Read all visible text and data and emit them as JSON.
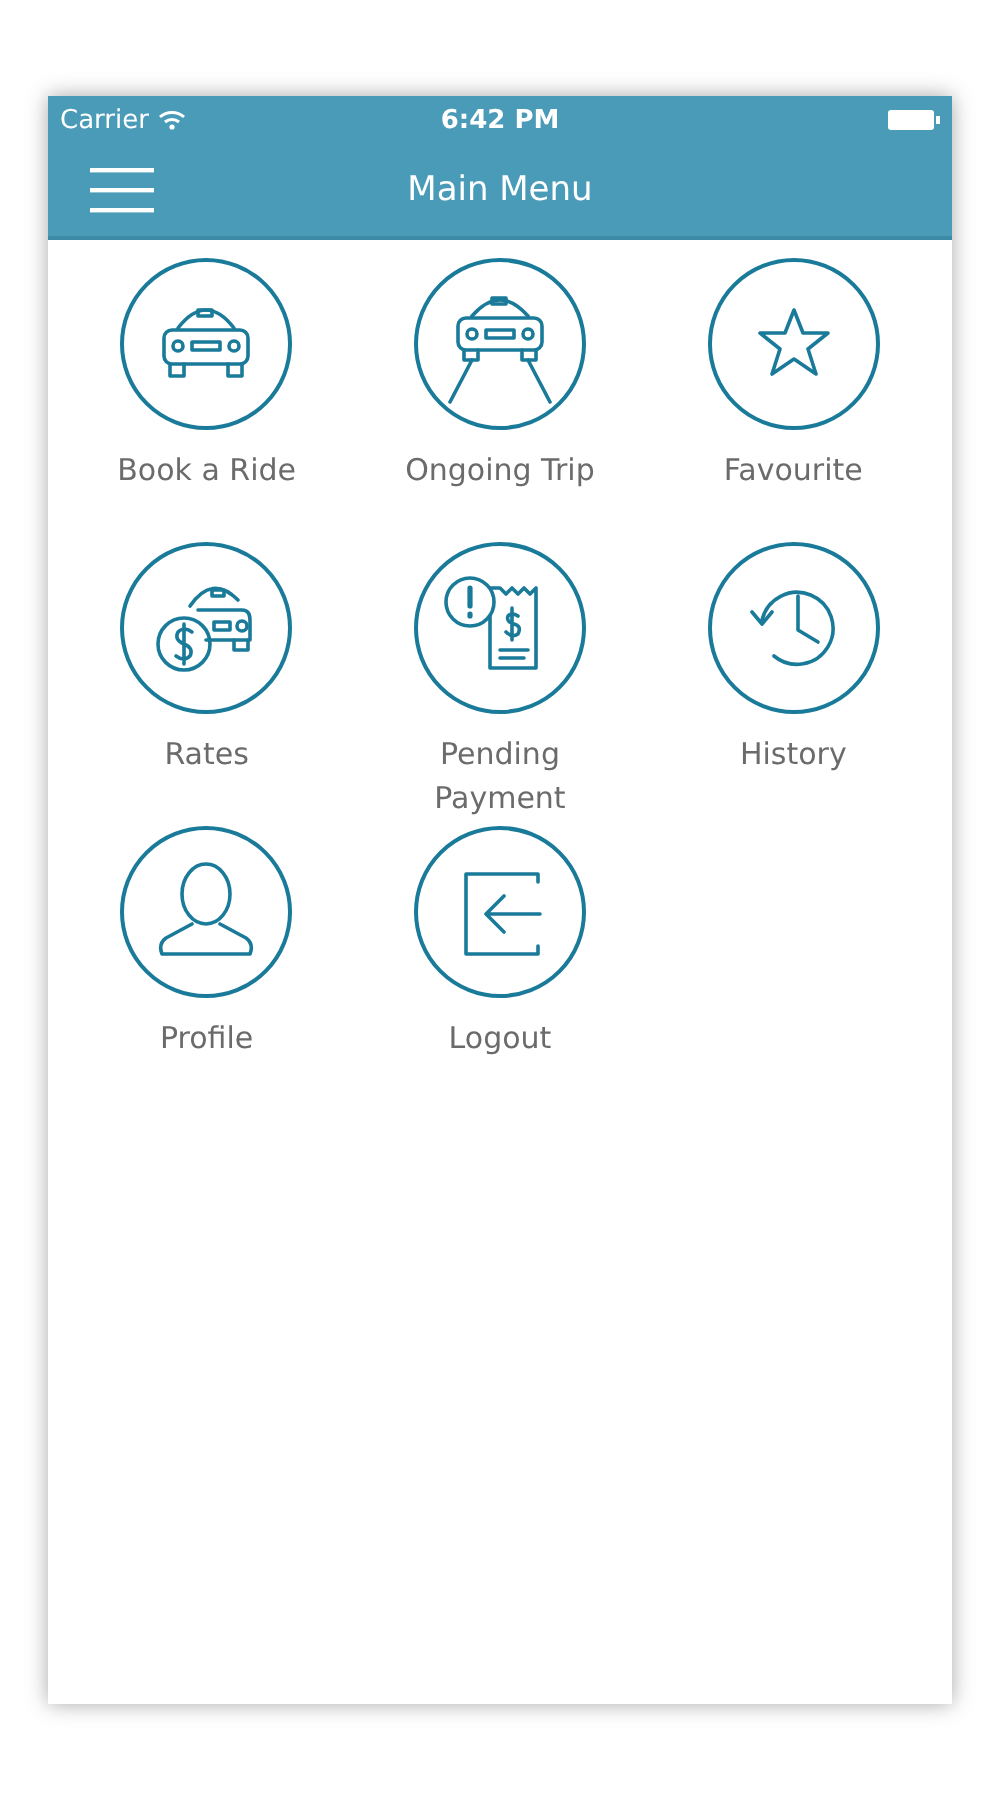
{
  "status_bar": {
    "carrier": "Carrier",
    "time": "6:42 PM"
  },
  "nav_bar": {
    "title": "Main Menu"
  },
  "menu_items": [
    {
      "label": "Book a Ride",
      "kind": "car"
    },
    {
      "label": "Ongoing Trip",
      "kind": "car-road"
    },
    {
      "label": "Favourite",
      "kind": "star"
    },
    {
      "label": "Rates",
      "kind": "car-dollar"
    },
    {
      "label": "Pending Payment",
      "kind": "receipt"
    },
    {
      "label": "History",
      "kind": "history"
    },
    {
      "label": "Profile",
      "kind": "person"
    },
    {
      "label": "Logout",
      "kind": "logout"
    }
  ]
}
